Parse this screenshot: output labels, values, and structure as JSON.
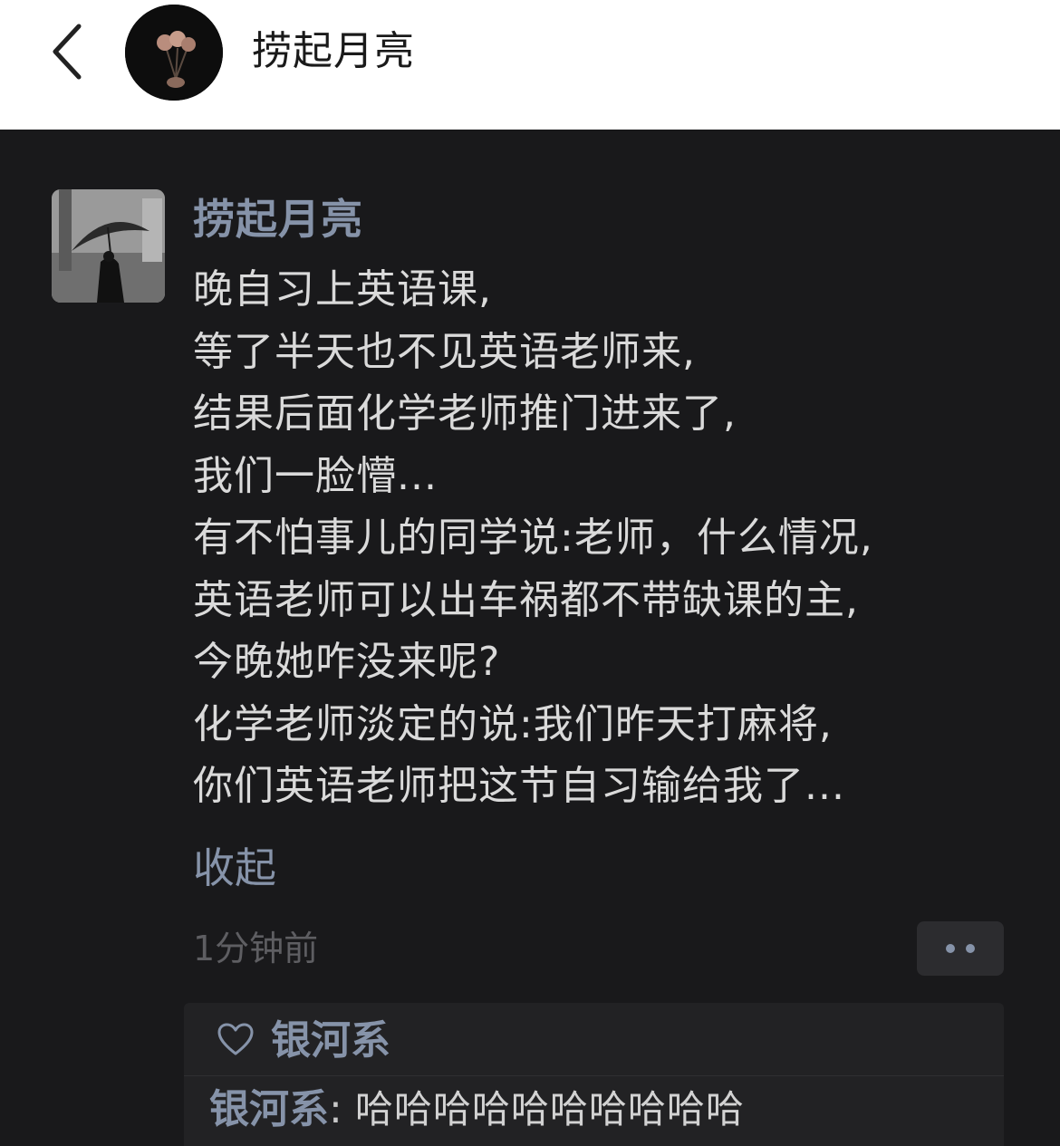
{
  "header": {
    "title": "捞起月亮"
  },
  "post": {
    "author": "捞起月亮",
    "lines": [
      "晚自习上英语课,",
      "等了半天也不见英语老师来,",
      "结果后面化学老师推门进来了,",
      "我们一脸懵...",
      "有不怕事儿的同学说:老师，什么情况,",
      "英语老师可以出车祸都不带缺课的主,",
      "今晚她咋没来呢?",
      "化学老师淡定的说:我们昨天打麻将,",
      "你们英语老师把这节自习输给我了..."
    ],
    "collapse_label": "收起",
    "timestamp": "1分钟前"
  },
  "likes": {
    "names": "银河系"
  },
  "comments": [
    {
      "author": "银河系",
      "separator": ": ",
      "text": "哈哈哈哈哈哈哈哈哈哈"
    }
  ],
  "colors": {
    "accent": "#8693a9",
    "panel_bg": "#19191b",
    "text": "#dadada",
    "muted": "#5e5e62"
  }
}
